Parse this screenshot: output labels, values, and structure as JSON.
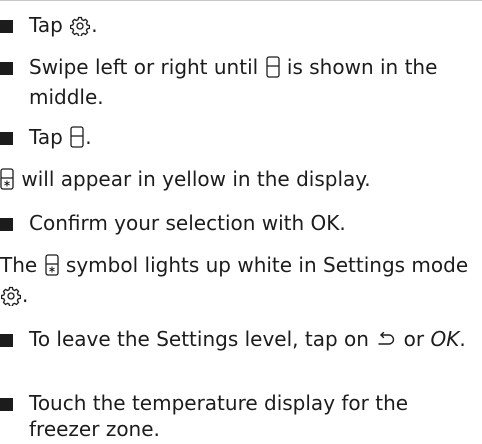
{
  "icons": {
    "settings": "gear-icon",
    "freeze": "fridge-compartment-icon",
    "freeze_active": "fridge-snowflake-icon",
    "back": "return-arrow-icon"
  },
  "steps": {
    "s1_a": "Tap",
    "s1_b": ".",
    "s2_a": "Swipe left or right until",
    "s2_b": "is shown in the middle.",
    "s3_a": "Tap",
    "s3_b": ".",
    "note1": "will appear in yellow in the display.",
    "s4": "Confirm your selection with OK.",
    "note2_a": "The",
    "note2_b": "symbol lights up white in Settings mode",
    "note2_c": ".",
    "s5_a": "To leave the Settings level, tap on",
    "s5_b": "or",
    "s5_ok": "OK",
    "s5_c": ".",
    "s6": "Touch the temperature display for the freezer zone."
  }
}
